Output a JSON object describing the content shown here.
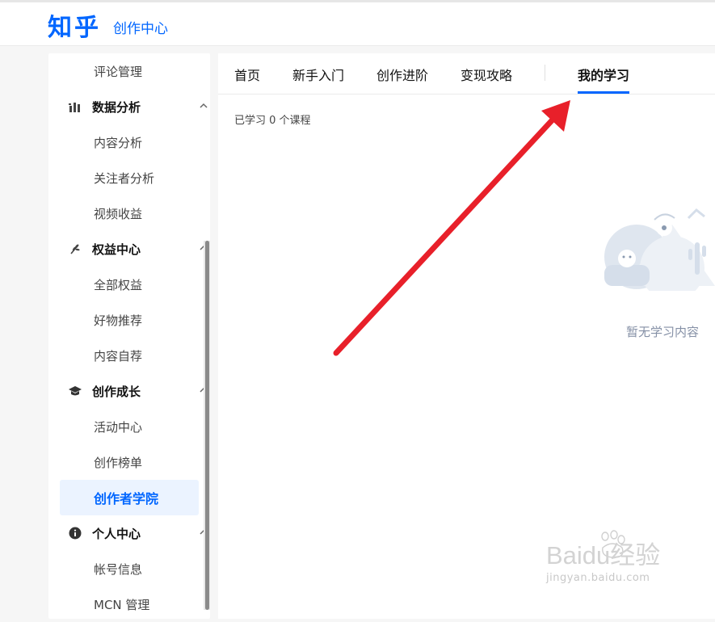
{
  "header": {
    "logo": "知乎",
    "subtitle": "创作中心"
  },
  "sidebar": {
    "items": [
      {
        "label": "评论管理",
        "kind": "item"
      },
      {
        "label": "数据分析",
        "kind": "section",
        "icon": "bar-chart-icon",
        "expanded": true
      },
      {
        "label": "内容分析",
        "kind": "item"
      },
      {
        "label": "关注者分析",
        "kind": "item"
      },
      {
        "label": "视频收益",
        "kind": "item"
      },
      {
        "label": "权益中心",
        "kind": "section",
        "icon": "wheat-icon",
        "expanded": true
      },
      {
        "label": "全部权益",
        "kind": "item"
      },
      {
        "label": "好物推荐",
        "kind": "item"
      },
      {
        "label": "内容自荐",
        "kind": "item"
      },
      {
        "label": "创作成长",
        "kind": "section",
        "icon": "graduation-cap-icon",
        "expanded": true
      },
      {
        "label": "活动中心",
        "kind": "item"
      },
      {
        "label": "创作榜单",
        "kind": "item"
      },
      {
        "label": "创作者学院",
        "kind": "item",
        "active": true
      },
      {
        "label": "个人中心",
        "kind": "section",
        "icon": "info-icon",
        "expanded": true
      },
      {
        "label": "帐号信息",
        "kind": "item"
      },
      {
        "label": "MCN 管理",
        "kind": "item"
      }
    ]
  },
  "main": {
    "tabs": [
      {
        "label": "首页"
      },
      {
        "label": "新手入门"
      },
      {
        "label": "创作进阶"
      },
      {
        "label": "变现攻略"
      },
      {
        "label": "我的学习",
        "active": true
      }
    ],
    "learned_count_text": "已学习 0 个课程",
    "empty_text": "暂无学习内容"
  },
  "colors": {
    "brand": "#0066ff",
    "active_bg": "#ebf3ff",
    "annotation_arrow": "#e8202a"
  },
  "watermark": {
    "logo": "Baidu经验",
    "url": "jingyan.baidu.com"
  }
}
